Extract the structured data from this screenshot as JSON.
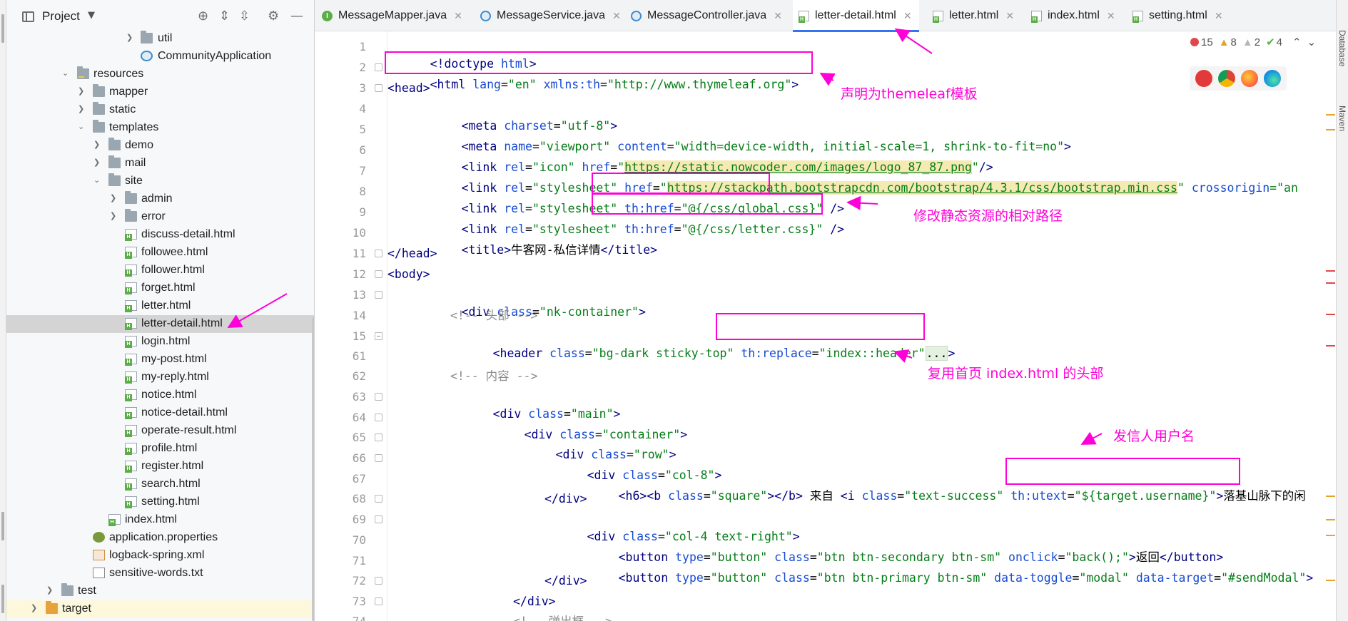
{
  "project_panel": {
    "title": "Project",
    "items": [
      {
        "label": "util",
        "type": "folder"
      },
      {
        "label": "CommunityApplication",
        "type": "java"
      },
      {
        "label": "resources",
        "type": "folder"
      },
      {
        "label": "mapper",
        "type": "folder"
      },
      {
        "label": "static",
        "type": "folder"
      },
      {
        "label": "templates",
        "type": "folder"
      },
      {
        "label": "demo",
        "type": "folder"
      },
      {
        "label": "mail",
        "type": "folder"
      },
      {
        "label": "site",
        "type": "folder"
      },
      {
        "label": "admin",
        "type": "folder"
      },
      {
        "label": "error",
        "type": "folder"
      },
      {
        "label": "discuss-detail.html",
        "type": "html"
      },
      {
        "label": "followee.html",
        "type": "html"
      },
      {
        "label": "follower.html",
        "type": "html"
      },
      {
        "label": "forget.html",
        "type": "html"
      },
      {
        "label": "letter.html",
        "type": "html"
      },
      {
        "label": "letter-detail.html",
        "type": "html",
        "selected": true
      },
      {
        "label": "login.html",
        "type": "html"
      },
      {
        "label": "my-post.html",
        "type": "html"
      },
      {
        "label": "my-reply.html",
        "type": "html"
      },
      {
        "label": "notice.html",
        "type": "html"
      },
      {
        "label": "notice-detail.html",
        "type": "html"
      },
      {
        "label": "operate-result.html",
        "type": "html"
      },
      {
        "label": "profile.html",
        "type": "html"
      },
      {
        "label": "register.html",
        "type": "html"
      },
      {
        "label": "search.html",
        "type": "html"
      },
      {
        "label": "setting.html",
        "type": "html"
      },
      {
        "label": "index.html",
        "type": "html"
      },
      {
        "label": "application.properties",
        "type": "properties"
      },
      {
        "label": "logback-spring.xml",
        "type": "xml"
      },
      {
        "label": "sensitive-words.txt",
        "type": "text"
      },
      {
        "label": "test",
        "type": "folder"
      },
      {
        "label": "target",
        "type": "folder"
      }
    ]
  },
  "tabs": [
    {
      "label": "MessageMapper.java",
      "icon": "interface-icon"
    },
    {
      "label": "MessageService.java",
      "icon": "class-icon"
    },
    {
      "label": "MessageController.java",
      "icon": "class-icon"
    },
    {
      "label": "letter-detail.html",
      "icon": "html-file-icon",
      "active": true
    },
    {
      "label": "letter.html",
      "icon": "html-file-icon"
    },
    {
      "label": "index.html",
      "icon": "html-file-icon"
    },
    {
      "label": "setting.html",
      "icon": "html-file-icon"
    }
  ],
  "line_numbers": [
    "1",
    "2",
    "3",
    "4",
    "5",
    "6",
    "7",
    "8",
    "9",
    "10",
    "11",
    "12",
    "13",
    "14",
    "15",
    "61",
    "62",
    "63",
    "64",
    "65",
    "66",
    "67",
    "68",
    "69",
    "70",
    "71",
    "72",
    "73",
    "74"
  ],
  "code": {
    "l1a": "<!doctype",
    "l1b": " html",
    "l1c": ">",
    "l2a": "<html",
    "l2b": " lang",
    "l2c": "=",
    "l2d": "\"en\"",
    "l2e": " xmlns:th",
    "l2f": "=",
    "l2g": "\"http://www.thymeleaf.org\"",
    "l2h": ">",
    "l3": "<head>",
    "l4a": "<meta",
    "l4b": " charset",
    "l4c": "=",
    "l4d": "\"utf-8\"",
    "l4e": ">",
    "l5a": "<meta",
    "l5b": " name",
    "l5c": "=",
    "l5d": "\"viewport\"",
    "l5e": " content",
    "l5f": "=",
    "l5g": "\"width=device-width, initial-scale=1, shrink-to-fit=no\"",
    "l5h": ">",
    "l6a": "<link",
    "l6b": " rel",
    "l6c": "=",
    "l6d": "\"icon\"",
    "l6e": " href",
    "l6f": "=",
    "l6g": "\"",
    "l6h": "https://static.nowcoder.com/images/logo_87_87.png",
    "l6i": "\"",
    "l6j": "/>",
    "l7a": "<link",
    "l7b": " rel",
    "l7c": "=",
    "l7d": "\"stylesheet\"",
    "l7e": " href",
    "l7f": "=",
    "l7g": "\"",
    "l7h": "https://stackpath.bootstrapcdn.com/bootstrap/4.3.1/css/bootstrap.min.css",
    "l7i": "\"",
    "l7j": " crossorigin",
    "l7k": "=\"an",
    "l8a": "<link",
    "l8b": " rel",
    "l8c": "=",
    "l8d": "\"stylesheet\"",
    "l8e": " th:href",
    "l8f": "=",
    "l8g": "\"@{/css/global.css}\"",
    "l8h": " />",
    "l9a": "<link",
    "l9b": " rel",
    "l9c": "=",
    "l9d": "\"stylesheet\"",
    "l9e": " th:href",
    "l9f": "=",
    "l9g": "\"@{/css/letter.css}\"",
    "l9h": " />",
    "l10a": "<title>",
    "l10b": "牛客网-私信详情",
    "l10c": "</title>",
    "l11": "</head>",
    "l12": "<body>",
    "l13a": "<div",
    "l13b": " class",
    "l13c": "=",
    "l13d": "\"nk-container\"",
    "l13e": ">",
    "l14": "<!-- 头部 -->",
    "l15a": "<header",
    "l15b": " class",
    "l15c": "=",
    "l15d": "\"bg-dark sticky-top\"",
    "l15e": " th:replace",
    "l15f": "=",
    "l15g": "\"index::header\"",
    "l15h": "...",
    "l15i": ">",
    "l61": "",
    "l62": "<!-- 内容 -->",
    "l63a": "<div",
    "l63b": " class",
    "l63c": "=",
    "l63d": "\"main\"",
    "l63e": ">",
    "l64a": "<div",
    "l64b": " class",
    "l64c": "=",
    "l64d": "\"container\"",
    "l64e": ">",
    "l65a": "<div",
    "l65b": " class",
    "l65c": "=",
    "l65d": "\"row\"",
    "l65e": ">",
    "l66a": "<div",
    "l66b": " class",
    "l66c": "=",
    "l66d": "\"col-8\"",
    "l66e": ">",
    "l67a": "<h6><b",
    "l67b": " class",
    "l67c": "=",
    "l67d": "\"square\"",
    "l67e": "></b>",
    "l67f": " 来自 ",
    "l67g": "<i",
    "l67h": " class",
    "l67i": "=",
    "l67j": "\"text-success\"",
    "l67k": " th:utext",
    "l67l": "=",
    "l67m": "\"${target.username}\"",
    "l67n": ">",
    "l67o": "落基山脉下的闲",
    "l68": "</div>",
    "l69a": "<div",
    "l69b": " class",
    "l69c": "=",
    "l69d": "\"col-4 text-right\"",
    "l69e": ">",
    "l70a": "<button",
    "l70b": " type",
    "l70c": "=",
    "l70d": "\"button\"",
    "l70e": " class",
    "l70f": "=",
    "l70g": "\"btn btn-secondary btn-sm\"",
    "l70h": " onclick",
    "l70i": "=",
    "l70j": "\"back();\"",
    "l70k": ">",
    "l70l": "返回",
    "l70m": "</button>",
    "l71a": "<button",
    "l71b": " type",
    "l71c": "=",
    "l71d": "\"button\"",
    "l71e": " class",
    "l71f": "=",
    "l71g": "\"btn btn-primary btn-sm\"",
    "l71h": " data-toggle",
    "l71i": "=",
    "l71j": "\"modal\"",
    "l71k": " data-target",
    "l71l": "=",
    "l71m": "\"#sendModal\"",
    "l71n": ">",
    "l72": "</div>",
    "l73": "</div>",
    "l74": "<!-- 弹出框 -->"
  },
  "annotations": {
    "declare_template": "声明为themeleaf模板",
    "static_path": "修改静态资源的相对路径",
    "reuse_header": "复用首页 index.html 的头部",
    "sender_username": "发信人用户名"
  },
  "inspections": {
    "errors": "15",
    "warnings": "8",
    "weak_warnings": "2",
    "ok": "4"
  },
  "right_strip": {
    "database": "Database",
    "maven": "Maven"
  },
  "colors": {
    "annotation": "#ff00d8",
    "tag": "#000080",
    "attr": "#174ad4",
    "string": "#067d17",
    "comment": "#8c8c8c",
    "active_tab_underline": "#3574f0"
  }
}
